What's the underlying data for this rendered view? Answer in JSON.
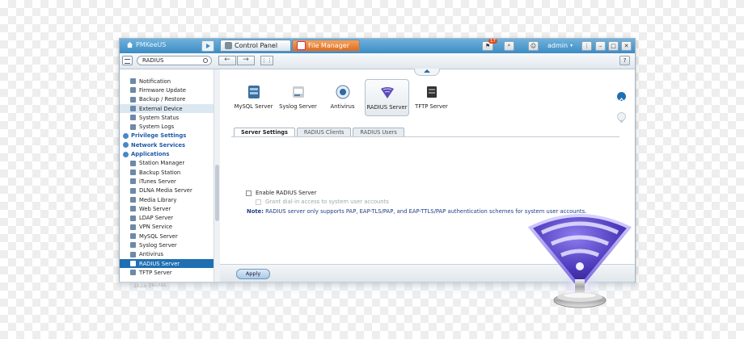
{
  "topbar": {
    "user_label": "PMKeeUS",
    "tabs": [
      {
        "label": "Control Panel"
      },
      {
        "label": "File Manager"
      }
    ],
    "notification_count": "17",
    "username": "admin"
  },
  "toolbar": {
    "search_value": "RADIUS",
    "back_glyph": "←",
    "forward_glyph": "→",
    "help_glyph": "?"
  },
  "sidebar": {
    "items": [
      {
        "label": "Notification",
        "type": "item"
      },
      {
        "label": "Firmware Update",
        "type": "item"
      },
      {
        "label": "Backup / Restore",
        "type": "item"
      },
      {
        "label": "External Device",
        "type": "item",
        "state": "hover"
      },
      {
        "label": "System Status",
        "type": "item"
      },
      {
        "label": "System Logs",
        "type": "item"
      },
      {
        "label": "Privilege Settings",
        "type": "group"
      },
      {
        "label": "Network Services",
        "type": "group"
      },
      {
        "label": "Applications",
        "type": "group"
      },
      {
        "label": "Station Manager",
        "type": "item"
      },
      {
        "label": "Backup Station",
        "type": "item"
      },
      {
        "label": "iTunes Server",
        "type": "item"
      },
      {
        "label": "DLNA Media Server",
        "type": "item"
      },
      {
        "label": "Media Library",
        "type": "item"
      },
      {
        "label": "Web Server",
        "type": "item"
      },
      {
        "label": "LDAP Server",
        "type": "item"
      },
      {
        "label": "VPN Service",
        "type": "item"
      },
      {
        "label": "MySQL Server",
        "type": "item"
      },
      {
        "label": "Syslog Server",
        "type": "item"
      },
      {
        "label": "Antivirus",
        "type": "item"
      },
      {
        "label": "RADIUS Server",
        "type": "item",
        "state": "selected"
      },
      {
        "label": "TFTP Server",
        "type": "item"
      }
    ]
  },
  "apps": [
    {
      "label": "MySQL Server",
      "icon": "database-icon"
    },
    {
      "label": "Syslog Server",
      "icon": "syslog-icon"
    },
    {
      "label": "Antivirus",
      "icon": "antivirus-icon"
    },
    {
      "label": "RADIUS Server",
      "icon": "radius-icon",
      "active": true
    },
    {
      "label": "TFTP Server",
      "icon": "tftp-icon"
    }
  ],
  "subtabs": [
    {
      "label": "Server Settings",
      "active": true
    },
    {
      "label": "RADIUS Clients"
    },
    {
      "label": "RADIUS Users"
    }
  ],
  "settings": {
    "enable_label": "Enable RADIUS Server",
    "grant_label": "Grant dial-in access to system user accounts",
    "note_prefix": "Note:",
    "note_text": " RADIUS server only supports PAP, EAP-TLS/PAP, and EAP-TTLS/PAP authentication schemes for system user accounts."
  },
  "footer": {
    "apply_label": "Apply"
  },
  "reflection_text": "TFTP Server",
  "colors": {
    "accent": "#3d8cc4",
    "selected": "#1f6fb2",
    "note": "#1d3f86",
    "radius_purple": "#6a5acd"
  }
}
